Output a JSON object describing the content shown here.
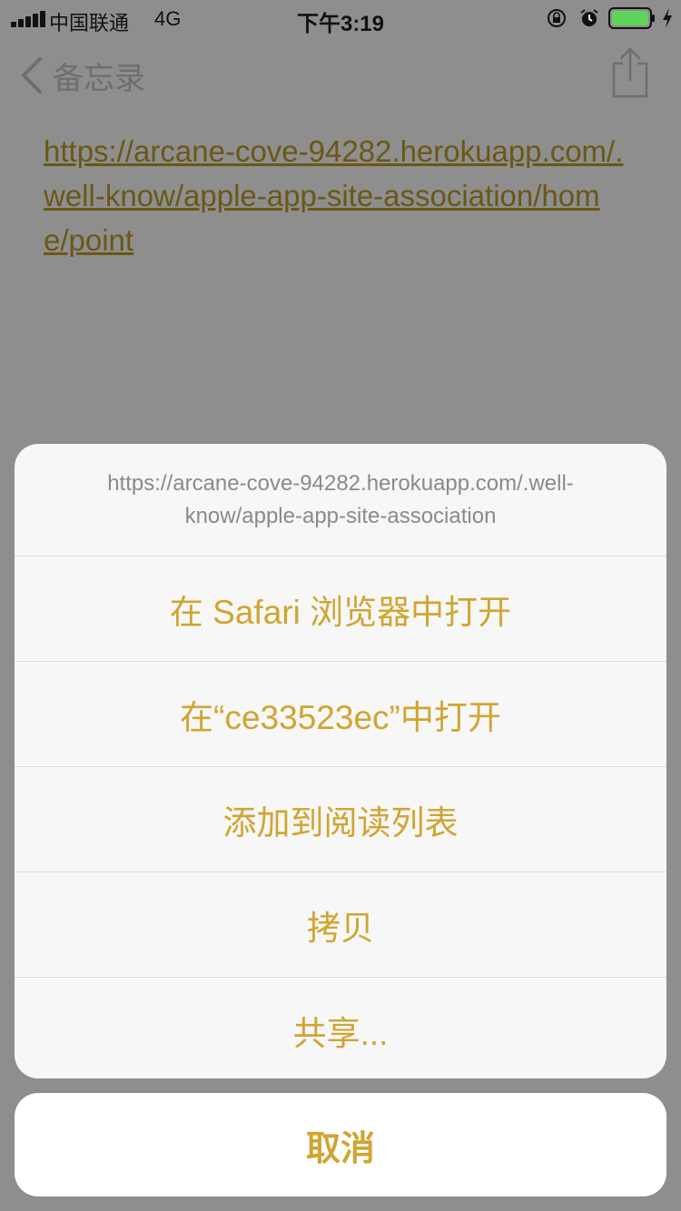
{
  "status_bar": {
    "carrier": "中国联通",
    "network": "4G",
    "time": "下午3:19",
    "icons": [
      "signal-icon",
      "orientation-lock-icon",
      "alarm-icon",
      "battery-icon",
      "charging-icon"
    ]
  },
  "nav": {
    "back_label": "备忘录",
    "back_icon": "chevron-left-icon",
    "share_icon": "share-icon"
  },
  "note": {
    "link_text": "https://arcane-cove-94282.herokuapp.com/.well-know/apple-app-site-association/home/point"
  },
  "action_sheet": {
    "header": "https://arcane-cove-94282.herokuapp.com/.well-know/apple-app-site-association",
    "items": [
      {
        "label": "在 Safari 浏览器中打开"
      },
      {
        "label": "在“ce33523ec”中打开"
      },
      {
        "label": "添加到阅读列表"
      },
      {
        "label": "拷贝"
      },
      {
        "label": "共享..."
      }
    ],
    "cancel_label": "取消"
  },
  "colors": {
    "accent": "#d0a531",
    "dim_background": "#8e8e8e",
    "sheet_background": "#f7f7f7"
  }
}
